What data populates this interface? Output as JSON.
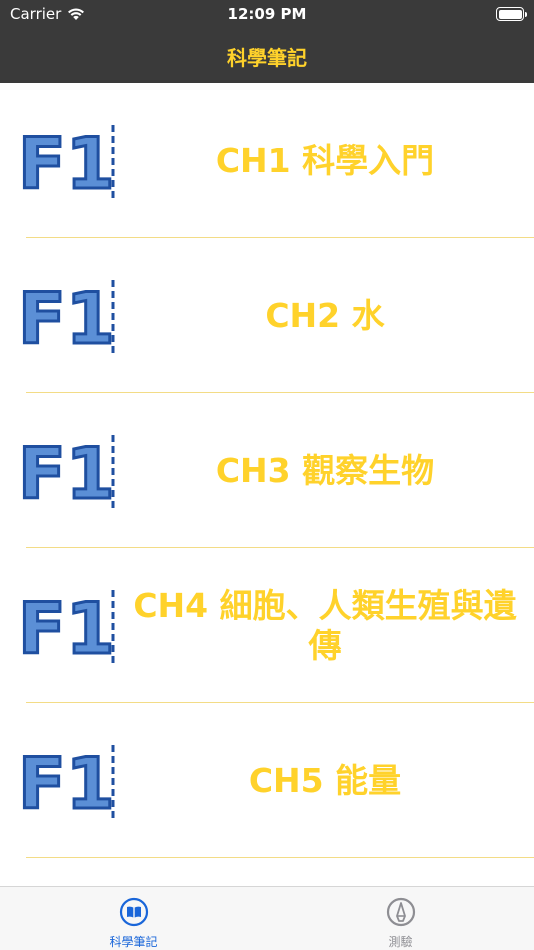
{
  "status_bar": {
    "carrier": "Carrier",
    "time": "12:09 PM"
  },
  "nav": {
    "title": "科學筆記"
  },
  "chapters": [
    {
      "label": "CH1 科學入門"
    },
    {
      "label": "CH2 水"
    },
    {
      "label": "CH3 觀察生物"
    },
    {
      "label": "CH4 細胞、人類生殖與遺傳"
    },
    {
      "label": "CH5 能量"
    }
  ],
  "thumbnail": {
    "text": "F1"
  },
  "tabs": [
    {
      "label": "科學筆記",
      "icon": "book-icon",
      "active": true
    },
    {
      "label": "測驗",
      "icon": "pencil-icon",
      "active": false
    }
  ],
  "colors": {
    "nav_bg": "#3a3a3a",
    "accent": "#ffd22b",
    "tab_active": "#1a66d9",
    "tab_inactive": "#8e8e93",
    "thumb_fill": "#5b8fd6",
    "thumb_stroke": "#1f4fa0"
  }
}
